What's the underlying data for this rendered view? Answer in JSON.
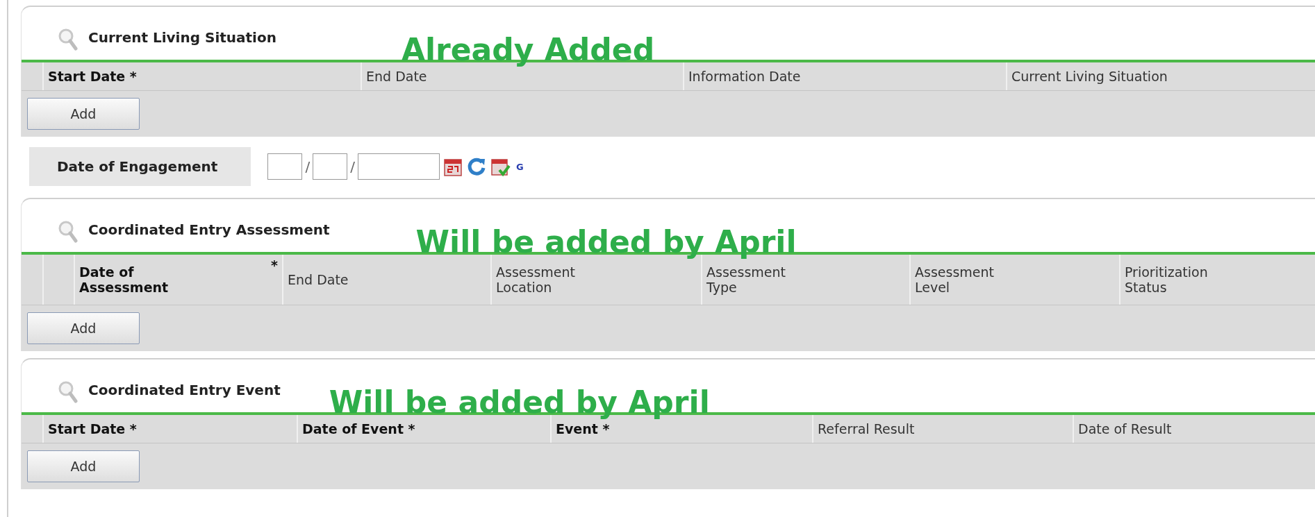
{
  "sections": [
    {
      "title": "Current Living Situation",
      "note": "Already Added",
      "columns": [
        {
          "label": "Start Date *",
          "required": true
        },
        {
          "label": "End Date",
          "required": false
        },
        {
          "label": "Information Date",
          "required": false
        },
        {
          "label": "Current Living Situation",
          "required": false
        }
      ],
      "button": "Add"
    },
    {
      "title": "Coordinated Entry Assessment",
      "note": "Will be added by April",
      "columns": [
        {
          "label": "Date of Assessment",
          "required": true,
          "asterisk": "*"
        },
        {
          "label": "End Date",
          "required": false
        },
        {
          "label": "Assessment Location",
          "required": false
        },
        {
          "label": "Assessment Type",
          "required": false
        },
        {
          "label": "Assessment Level",
          "required": false
        },
        {
          "label": "Prioritization Status",
          "required": false
        }
      ],
      "button": "Add"
    },
    {
      "title": "Coordinated Entry Event",
      "note": "Will be added by April",
      "columns": [
        {
          "label": "Start Date *",
          "required": true
        },
        {
          "label": "Date of Event *",
          "required": true
        },
        {
          "label": "Event *",
          "required": true
        },
        {
          "label": "Referral Result",
          "required": false
        },
        {
          "label": "Date of Result",
          "required": false
        }
      ],
      "button": "Add"
    }
  ],
  "engagement": {
    "label": "Date of Engagement",
    "separators": [
      "/",
      "/"
    ],
    "link": "G"
  }
}
